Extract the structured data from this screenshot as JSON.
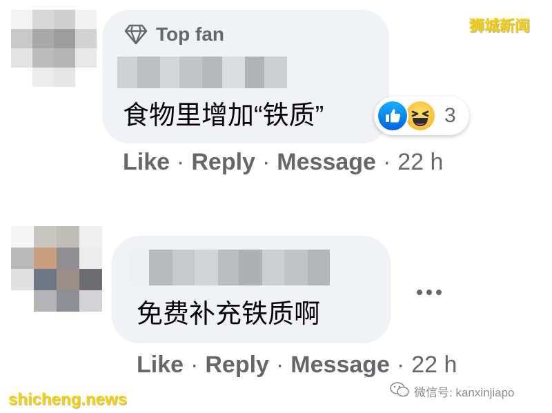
{
  "comments": [
    {
      "badge": "Top fan",
      "text": "食物里增加“铁质”",
      "reactions": {
        "count": "3",
        "icons": [
          "like-icon",
          "haha-icon"
        ]
      },
      "actions": {
        "like": "Like",
        "reply": "Reply",
        "message": "Message",
        "time": "22 h"
      }
    },
    {
      "text": "免费补充铁质啊",
      "actions": {
        "like": "Like",
        "reply": "Reply",
        "message": "Message",
        "time": "22 h"
      }
    }
  ],
  "separator": "·",
  "watermarks": {
    "top_right": "狮城新闻",
    "bottom_left": "shicheng.news",
    "wechat": "微信号: kanxinjiapo"
  },
  "colors": {
    "bubble": "#f0f2f5",
    "secondary_text": "#65676b",
    "like_blue": "#1877f2",
    "watermark_yellow": "#f5d100"
  }
}
